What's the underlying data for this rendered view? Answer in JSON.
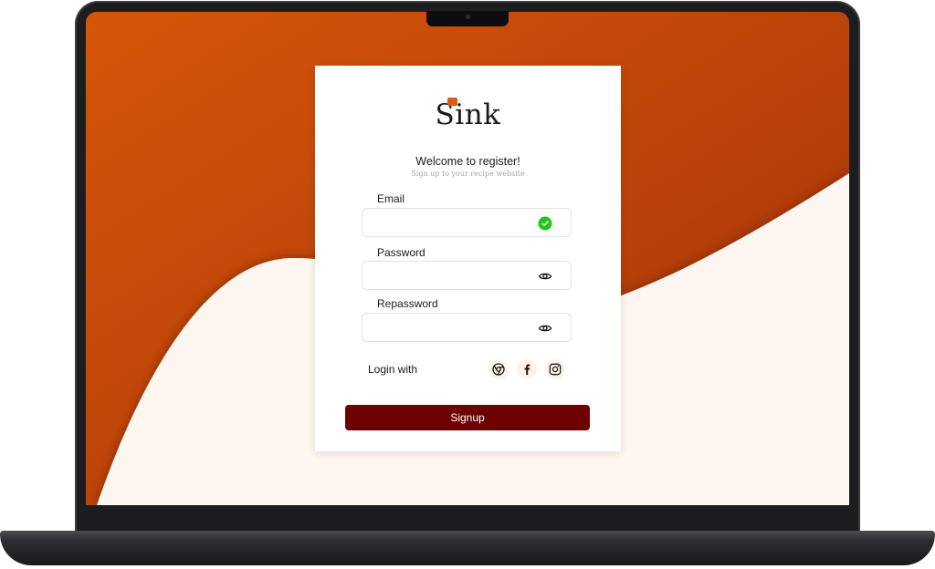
{
  "brand": {
    "logo_text": "Sink"
  },
  "register": {
    "welcome": "Welcome  to register!",
    "subtitle": "Sign up to your recipe website",
    "fields": [
      {
        "label": "Email",
        "value": "",
        "icon": "check-circle-icon"
      },
      {
        "label": "Password",
        "value": "",
        "icon": "eye-icon"
      },
      {
        "label": "Repassword",
        "value": "",
        "icon": "eye-icon"
      }
    ],
    "login_with": "Login with",
    "social": [
      "chrome-icon",
      "facebook-icon",
      "instagram-icon"
    ],
    "signup_label": "Signup"
  },
  "colors": {
    "accent": "#6d0000",
    "wallpaper_orange": "#c9470a",
    "wallpaper_cream": "#fdf7ef",
    "valid_green": "#22c31f"
  }
}
